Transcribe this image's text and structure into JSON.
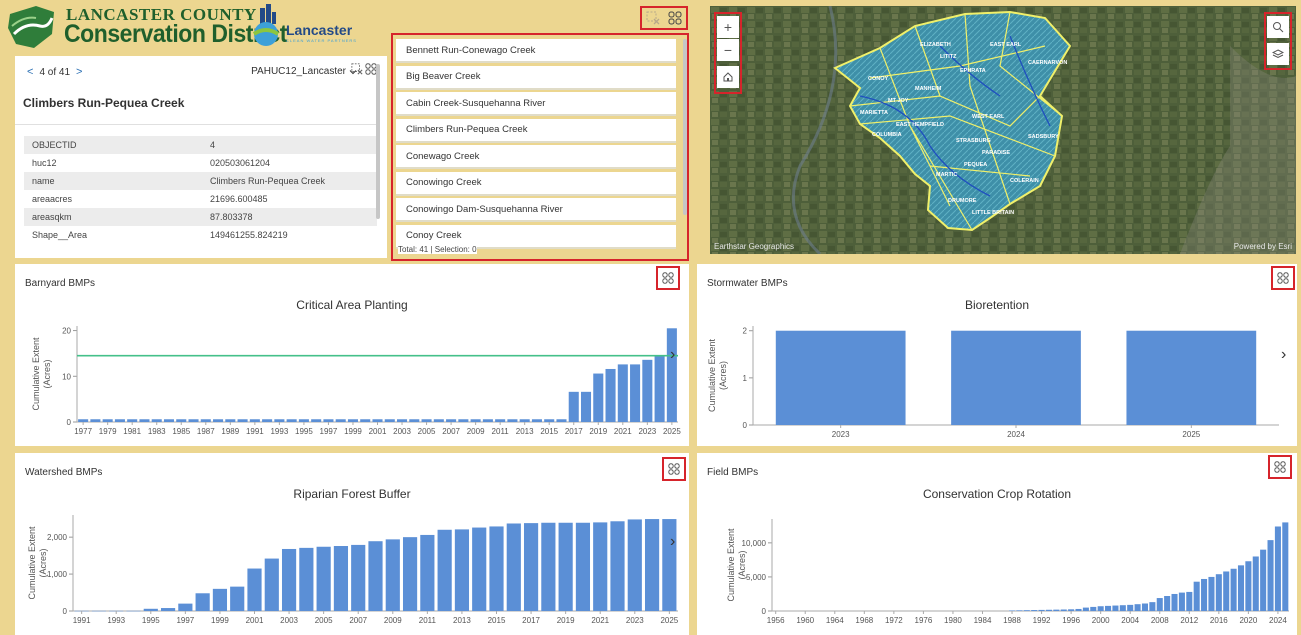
{
  "header": {
    "logo_line1": "LANCASTER COUNTY",
    "logo_line2": "Conservation District",
    "logo2_name": "Lancaster",
    "logo2_tagline": "CLEAN WATER PARTNERS"
  },
  "feature_info": {
    "prev": "<",
    "next": ">",
    "counter": "4 of 41",
    "layer": "PAHUC12_Lancaster",
    "title": "Climbers Run-Pequea Creek",
    "attributes": [
      {
        "key": "OBJECTID",
        "value": "4"
      },
      {
        "key": "huc12",
        "value": "020503061204"
      },
      {
        "key": "name",
        "value": "Climbers Run-Pequea Creek"
      },
      {
        "key": "areaacres",
        "value": "21696.600485"
      },
      {
        "key": "areasqkm",
        "value": "87.803378"
      },
      {
        "key": "Shape__Area",
        "value": "149461255.824219"
      }
    ]
  },
  "list": {
    "items": [
      "Bennett Run-Conewago Creek",
      "Big Beaver Creek",
      "Cabin Creek-Susquehanna River",
      "Climbers Run-Pequea Creek",
      "Conewago Creek",
      "Conowingo Creek",
      "Conowingo Dam-Susquehanna River",
      "Conoy Creek"
    ],
    "footer": "Total: 41 | Selection: 0"
  },
  "map": {
    "zoom_in": "+",
    "zoom_out": "−",
    "attribution_left": "Earthstar Geographics",
    "attribution_right": "Powered by Esri",
    "labels": [
      "MT JOY",
      "EAST HEMPFIELD",
      "MANHEIM",
      "EPHRATA",
      "EAST EARL",
      "WEST EARL",
      "STRASBURG",
      "PARADISE",
      "COLERAIN",
      "MARTIC",
      "DRUMORE",
      "SADSBURY",
      "COLUMBIA",
      "MARIETTA",
      "LITITZ",
      "ELIZABETH",
      "CAERNARVON",
      "CONOY",
      "PEQUEA",
      "LITTLE BRITAIN"
    ]
  },
  "colors": {
    "bar": "#5b8fd6",
    "target_line": "#44c08a",
    "highlight": "#d6242b",
    "background": "#ecd690"
  },
  "panels": {
    "barnyard": {
      "title": "Barnyard BMPs",
      "chart_title": "Critical Area Planting",
      "ylabel_1": "Cumulative Extent",
      "ylabel_2": "(Acres)"
    },
    "stormwater": {
      "title": "Stormwater BMPs",
      "chart_title": "Bioretention",
      "ylabel_1": "Cumulative Extent",
      "ylabel_2": "(Acres)"
    },
    "watershed": {
      "title": "Watershed BMPs",
      "chart_title": "Riparian Forest Buffer",
      "ylabel_1": "Cumulative Extent",
      "ylabel_2": "(Acres)"
    },
    "field": {
      "title": "Field BMPs",
      "chart_title": "Conservation Crop Rotation",
      "ylabel_1": "Cumulative Extent",
      "ylabel_2": "(Acres)"
    }
  },
  "chart_data": [
    {
      "id": "barnyard",
      "type": "bar",
      "title": "Critical Area Planting",
      "ylabel": "Cumulative Extent (Acres)",
      "ylim": [
        0,
        21
      ],
      "yticks": [
        0,
        10,
        20
      ],
      "target_line": 14.5,
      "categories": [
        1977,
        1978,
        1979,
        1980,
        1981,
        1982,
        1983,
        1984,
        1985,
        1986,
        1987,
        1988,
        1989,
        1990,
        1991,
        1992,
        1993,
        1994,
        1995,
        1996,
        1997,
        1998,
        1999,
        2000,
        2001,
        2002,
        2003,
        2004,
        2005,
        2006,
        2007,
        2008,
        2009,
        2010,
        2011,
        2012,
        2013,
        2014,
        2015,
        2016,
        2017,
        2018,
        2019,
        2020,
        2021,
        2022,
        2023,
        2024,
        2025
      ],
      "values": [
        0.6,
        0.6,
        0.6,
        0.6,
        0.6,
        0.6,
        0.6,
        0.6,
        0.6,
        0.6,
        0.6,
        0.6,
        0.6,
        0.6,
        0.6,
        0.6,
        0.6,
        0.6,
        0.6,
        0.6,
        0.6,
        0.6,
        0.6,
        0.6,
        0.6,
        0.6,
        0.6,
        0.6,
        0.6,
        0.6,
        0.6,
        0.6,
        0.6,
        0.6,
        0.6,
        0.6,
        0.6,
        0.6,
        0.6,
        0.6,
        6.6,
        6.6,
        10.6,
        11.6,
        12.6,
        12.6,
        13.6,
        14.6,
        20.5
      ],
      "tick_labels": [
        "1977",
        "1979",
        "1981",
        "1983",
        "1985",
        "1987",
        "1989",
        "1991",
        "1993",
        "1995",
        "1997",
        "1999",
        "2001",
        "2003",
        "2005",
        "2007",
        "2009",
        "2011",
        "2013",
        "2015",
        "2017",
        "2019",
        "2021",
        "2023",
        "2025"
      ]
    },
    {
      "id": "stormwater",
      "type": "bar",
      "title": "Bioretention",
      "ylabel": "Cumulative Extent (Acres)",
      "ylim": [
        0,
        2.1
      ],
      "yticks": [
        0,
        1,
        2
      ],
      "categories": [
        "2023",
        "2024",
        "2025"
      ],
      "values": [
        2,
        2,
        2
      ],
      "tick_labels": [
        "2023",
        "2024",
        "2025"
      ]
    },
    {
      "id": "watershed",
      "type": "bar",
      "title": "Riparian Forest Buffer",
      "ylabel": "Cumulative Extent (Acres)",
      "ylim": [
        0,
        2600
      ],
      "yticks": [
        0,
        1000,
        2000
      ],
      "ytick_labels": [
        "0",
        "1,000",
        "2,000"
      ],
      "categories": [
        1991,
        1992,
        1993,
        1994,
        1995,
        1996,
        1997,
        1998,
        1999,
        2000,
        2001,
        2002,
        2003,
        2004,
        2005,
        2006,
        2007,
        2008,
        2009,
        2010,
        2011,
        2012,
        2013,
        2014,
        2015,
        2016,
        2017,
        2018,
        2019,
        2020,
        2021,
        2022,
        2023,
        2024,
        2025
      ],
      "values": [
        5,
        5,
        5,
        5,
        60,
        80,
        200,
        480,
        600,
        660,
        1150,
        1420,
        1680,
        1710,
        1740,
        1760,
        1790,
        1890,
        1940,
        2000,
        2060,
        2200,
        2210,
        2260,
        2290,
        2370,
        2380,
        2390,
        2390,
        2390,
        2400,
        2430,
        2480,
        2490,
        2490
      ],
      "tick_labels": [
        "1991",
        "1993",
        "1995",
        "1997",
        "1999",
        "2001",
        "2003",
        "2005",
        "2007",
        "2009",
        "2011",
        "2013",
        "2015",
        "2017",
        "2019",
        "2021",
        "2023",
        "2025"
      ]
    },
    {
      "id": "field",
      "type": "bar",
      "title": "Conservation Crop Rotation",
      "ylabel": "Cumulative Extent (Acres)",
      "ylim": [
        0,
        13500
      ],
      "yticks": [
        0,
        5000,
        10000
      ],
      "ytick_labels": [
        "0",
        "5,000",
        "10,000"
      ],
      "categories": [
        1988,
        1989,
        1990,
        1991,
        1992,
        1993,
        1994,
        1995,
        1996,
        1997,
        1998,
        1999,
        2000,
        2001,
        2002,
        2003,
        2004,
        2005,
        2006,
        2007,
        2008,
        2009,
        2010,
        2011,
        2012,
        2013,
        2014,
        2015,
        2016,
        2017,
        2018,
        2019,
        2020,
        2021,
        2022,
        2023,
        2024,
        2025
      ],
      "values": [
        80,
        100,
        120,
        140,
        160,
        180,
        200,
        220,
        250,
        300,
        500,
        600,
        700,
        750,
        800,
        850,
        900,
        1000,
        1100,
        1300,
        1900,
        2200,
        2500,
        2700,
        2800,
        4300,
        4700,
        5000,
        5400,
        5800,
        6200,
        6700,
        7300,
        8000,
        9000,
        10400,
        12400,
        13000
      ],
      "tick_labels": [
        "1956",
        "1960",
        "1964",
        "1968",
        "1972",
        "1976",
        "1980",
        "1984",
        "1988",
        "1992",
        "1996",
        "2000",
        "2004",
        "2008",
        "2012",
        "2016",
        "2020",
        "2024"
      ],
      "x_start": 1956,
      "x_end": 2025
    }
  ]
}
